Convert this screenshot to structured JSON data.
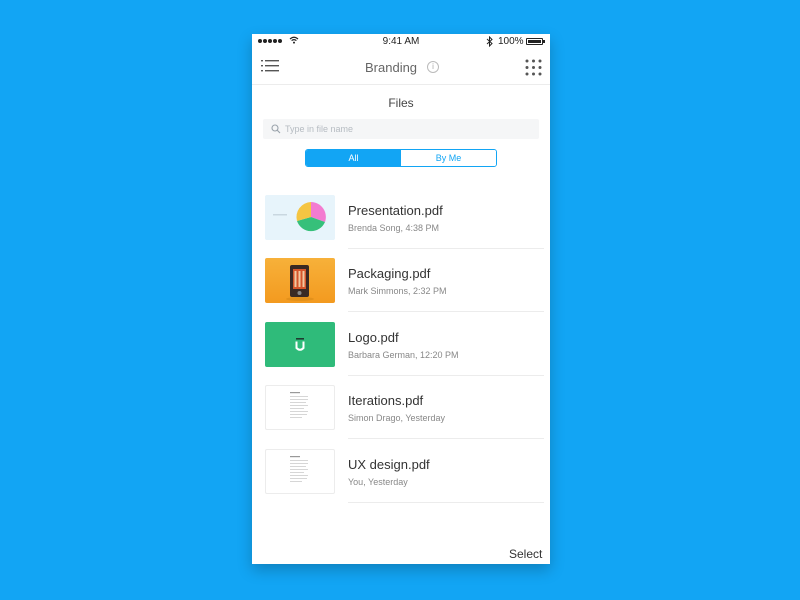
{
  "status_bar": {
    "time": "9:41 AM",
    "battery": "100%"
  },
  "navbar": {
    "title": "Branding"
  },
  "files_title": "Files",
  "search": {
    "placeholder": "Type in file name"
  },
  "segments": {
    "all_label": "All",
    "byme_label": "By Me"
  },
  "files": [
    {
      "name": "Presentation.pdf",
      "meta": "Brenda Song, 4:38 PM",
      "thumb_icon": "pie-chart-thumbnail",
      "thumb_bg": "#e7f4fb"
    },
    {
      "name": "Packaging.pdf",
      "meta": "Mark Simmons, 2:32 PM",
      "thumb_icon": "package-photo-thumbnail",
      "thumb_bg": "#f5a623"
    },
    {
      "name": "Logo.pdf",
      "meta": "Barbara German, 12:20 PM",
      "thumb_icon": "logo-thumbnail",
      "thumb_bg": "#2fbb7a"
    },
    {
      "name": "Iterations.pdf",
      "meta": "Simon Drago, Yesterday",
      "thumb_icon": "document-thumbnail",
      "thumb_bg": "#ffffff"
    },
    {
      "name": "UX design.pdf",
      "meta": "You, Yesterday",
      "thumb_icon": "document-thumbnail",
      "thumb_bg": "#ffffff"
    }
  ],
  "footer": {
    "select_label": "Select"
  },
  "colors": {
    "background": "#12a5f4",
    "accent": "#12a5f4"
  }
}
